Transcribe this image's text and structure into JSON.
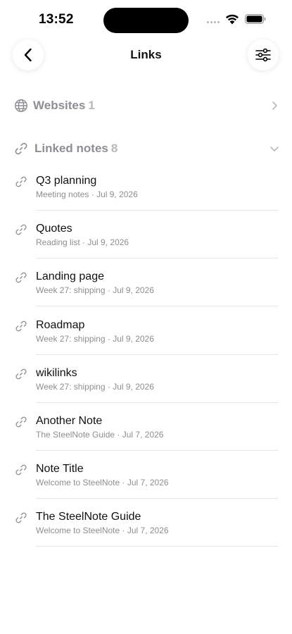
{
  "status_bar": {
    "time": "13:52"
  },
  "nav": {
    "title": "Links",
    "back_icon": "chevron-left-icon",
    "filter_icon": "sliders-icon"
  },
  "sections": {
    "websites": {
      "label": "Websites",
      "count": "1",
      "icon": "globe-icon",
      "state": "collapsed"
    },
    "linked_notes": {
      "label": "Linked notes",
      "count": "8",
      "icon": "link-icon",
      "state": "expanded"
    }
  },
  "notes": [
    {
      "title": "Q3 planning",
      "source": "Meeting notes",
      "date": "Jul 9, 2026"
    },
    {
      "title": "Quotes",
      "source": "Reading list",
      "date": "Jul 9, 2026"
    },
    {
      "title": "Landing page",
      "source": "Week 27: shipping",
      "date": "Jul 9, 2026"
    },
    {
      "title": "Roadmap",
      "source": "Week 27: shipping",
      "date": "Jul 9, 2026"
    },
    {
      "title": "wikilinks",
      "source": "Week 27: shipping",
      "date": "Jul 9, 2026"
    },
    {
      "title": "Another Note",
      "source": "The SteelNote Guide",
      "date": "Jul 7, 2026"
    },
    {
      "title": "Note Title",
      "source": "Welcome to SteelNote",
      "date": "Jul 7, 2026"
    },
    {
      "title": "The SteelNote Guide",
      "source": "Welcome to SteelNote",
      "date": "Jul 7, 2026"
    }
  ],
  "meta_separator": " · ",
  "colors": {
    "text_primary": "#111111",
    "text_secondary": "#8e8e93",
    "divider": "#e5e5ea",
    "background": "#ffffff"
  }
}
